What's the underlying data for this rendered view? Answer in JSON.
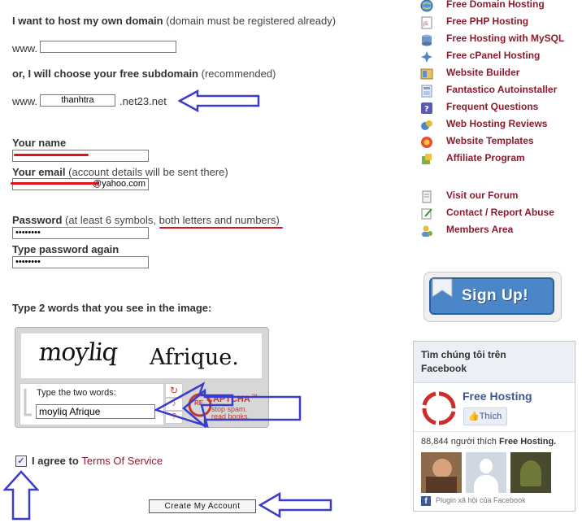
{
  "domain_section": {
    "own_domain_title": "I want to host my own domain",
    "own_domain_hint": "(domain must be registered already)",
    "www_label": "www.",
    "own_domain_value": "",
    "subdomain_title": "or, I will choose your free subdomain",
    "subdomain_hint": "(recommended)",
    "subdomain_value": "thanhtra",
    "subdomain_suffix": ".net23.net"
  },
  "account": {
    "name_label": "Your name",
    "name_value": "",
    "email_label": "Your email",
    "email_hint": "(account details will be sent there)",
    "email_value": "@yahoo.com",
    "password_label": "Password",
    "password_hint_a": "(at least 6 symbols,",
    "password_hint_b": "both letters and numbers)",
    "password_value": "••••••••",
    "password_again_label": "Type password again",
    "password_again_value": "••••••••"
  },
  "captcha": {
    "instruction": "Type 2 words that you see in the image:",
    "word1": "moyliq",
    "word2": "Afrique.",
    "input_label": "Type the two words:",
    "input_value": "moyliq Afrique",
    "brand_re": "RE",
    "brand": "CAPTCHA",
    "tm": "™",
    "tagline1": "stop spam.",
    "tagline2": "read books."
  },
  "terms": {
    "agree_text": "I agree to",
    "link_text": "Terms Of Service",
    "checked": true
  },
  "submit_label": "Create My Account",
  "nav": {
    "items": [
      {
        "label": "Free Domain Hosting",
        "icon": "globe-icon"
      },
      {
        "label": "Free PHP Hosting",
        "icon": "php-file-icon"
      },
      {
        "label": "Free Hosting with MySQL",
        "icon": "database-icon"
      },
      {
        "label": "Free cPanel Hosting",
        "icon": "cpanel-icon"
      },
      {
        "label": "Website Builder",
        "icon": "builder-icon"
      },
      {
        "label": "Fantastico Autoinstaller",
        "icon": "installer-icon"
      },
      {
        "label": "Frequent Questions",
        "icon": "help-icon"
      },
      {
        "label": "Web Hosting Reviews",
        "icon": "reviews-icon"
      },
      {
        "label": "Website Templates",
        "icon": "templates-icon"
      },
      {
        "label": "Affiliate Program",
        "icon": "affiliate-icon"
      }
    ],
    "items2": [
      {
        "label": "Visit our Forum",
        "icon": "forum-icon"
      },
      {
        "label": "Contact / Report Abuse",
        "icon": "contact-icon"
      },
      {
        "label": "Members Area",
        "icon": "members-icon"
      }
    ]
  },
  "signup_label": "Sign Up!",
  "facebook": {
    "header": "Tìm chúng tôi trên Facebook",
    "page_name": "Free Hosting",
    "like_label": "Thích",
    "like_count_text": "88,844 người thích",
    "like_count_page": "Free Hosting.",
    "plugin_text": "Plugin xã hội của Facebook"
  },
  "colors": {
    "link": "#8b1c2e",
    "annotation_red": "#d9141b",
    "annotation_blue": "#3b3bcc",
    "signup_blue": "#4a86c8"
  }
}
